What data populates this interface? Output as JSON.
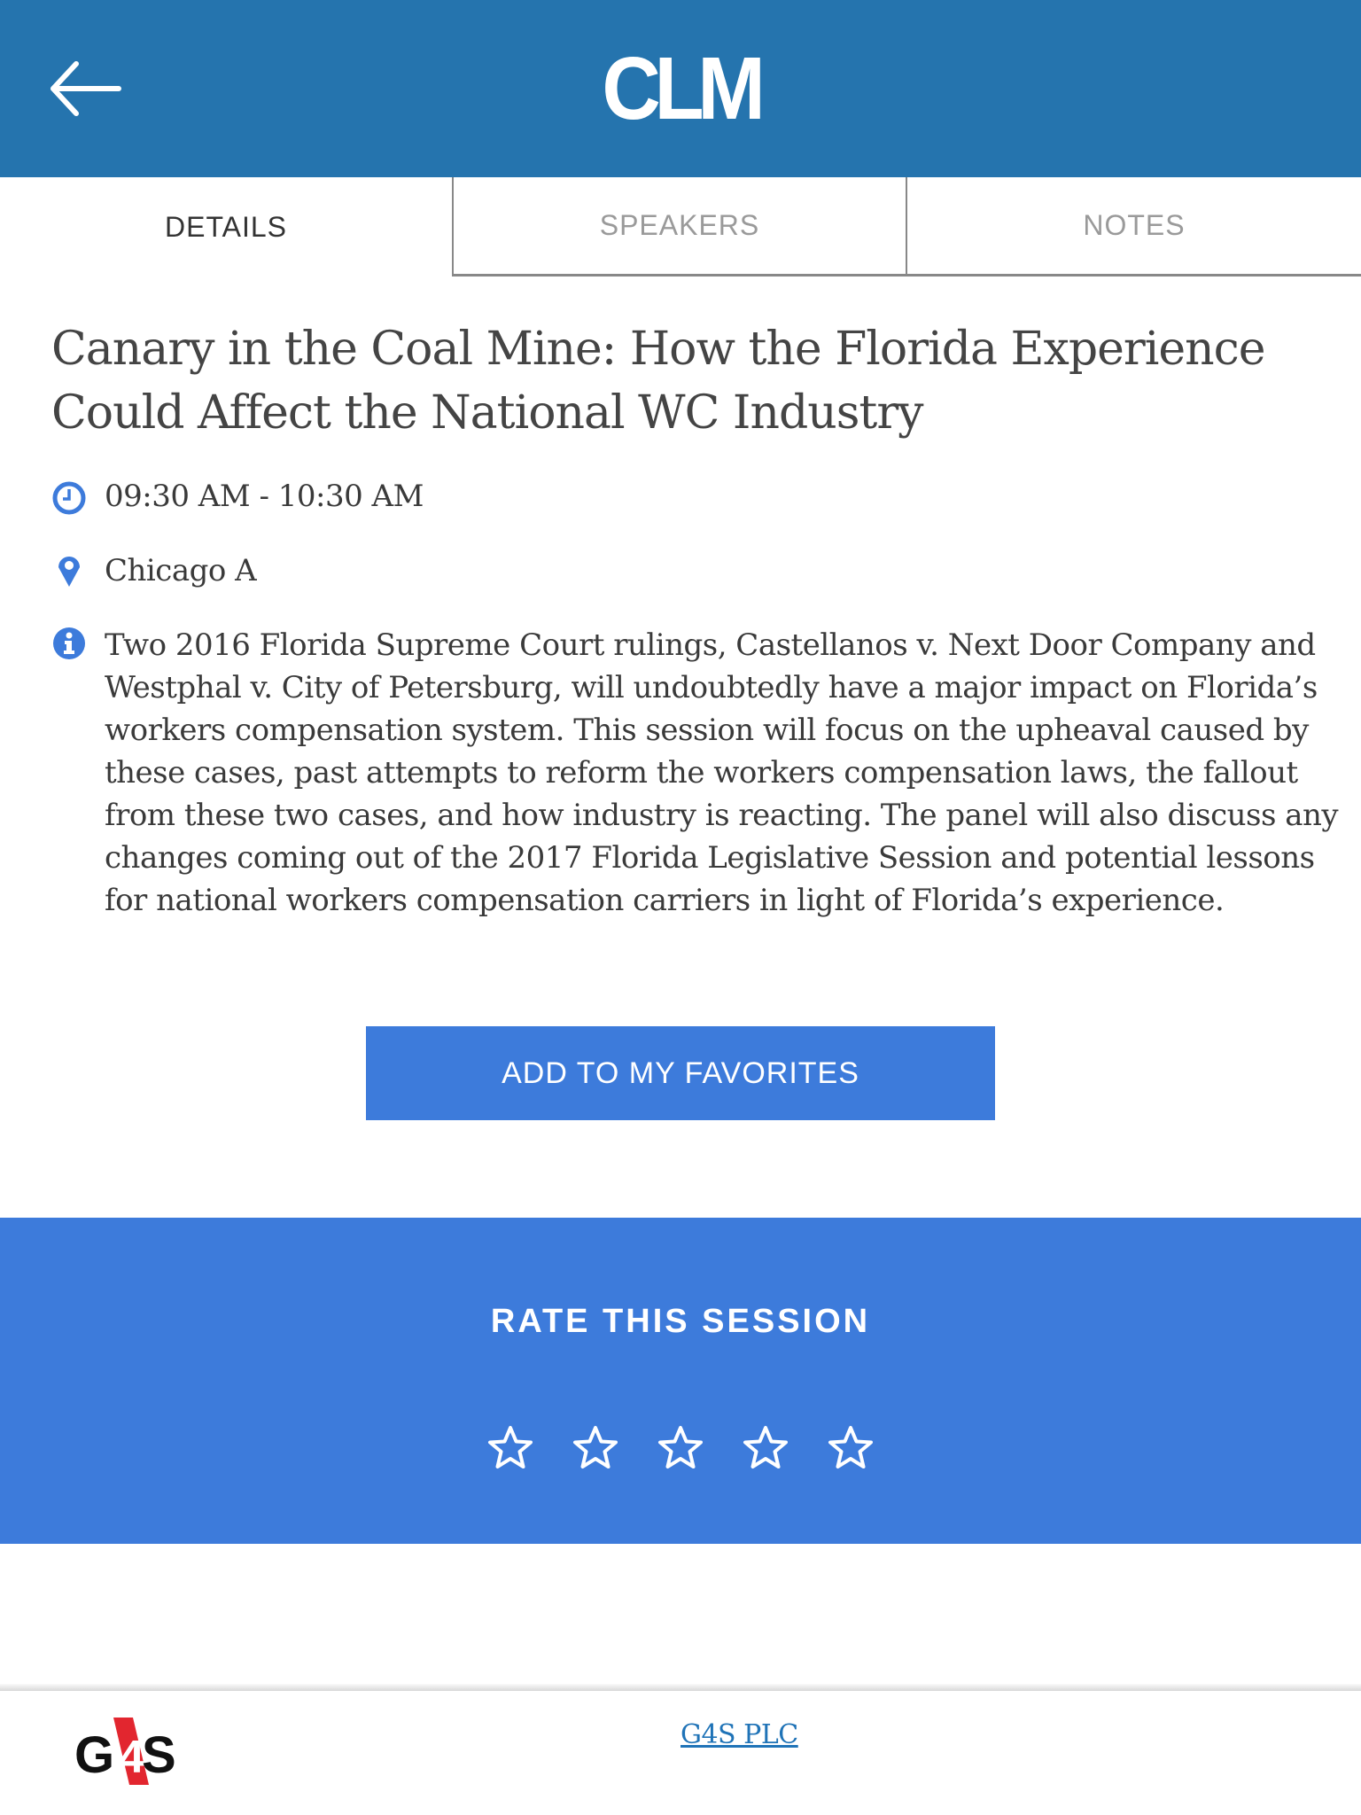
{
  "header": {
    "logo_text": "CLM",
    "back_icon": "arrow-left-icon",
    "background_color": "#2574ae"
  },
  "tabs": [
    {
      "label": "DETAILS",
      "active": true
    },
    {
      "label": "SPEAKERS",
      "active": false
    },
    {
      "label": "NOTES",
      "active": false
    }
  ],
  "session": {
    "title": "Canary in the Coal Mine: How the Florida Experience Could Affect the National WC Industry",
    "time": "09:30 AM - 10:30 AM",
    "time_icon": "clock-icon",
    "location": "Chicago A",
    "location_icon": "map-pin-icon",
    "description_icon": "info-icon",
    "description": "Two 2016 Florida Supreme Court rulings, Castellanos v. Next Door Company and Westphal v. City of Petersburg, will undoubtedly have a major impact on Florida’s workers compensation system.  This session will focus on the upheaval caused by these cases, past attempts to reform the workers compensation laws, the fallout from these two cases, and how industry is reacting.  The panel will also discuss any changes coming out of the 2017 Florida Legislative Session and potential lessons for national workers compensation carriers in light of Florida’s experience.",
    "accent_color": "#3d7bdb"
  },
  "favorites_button": {
    "label": "ADD TO MY FAVORITES"
  },
  "rating": {
    "title": "RATE THIS SESSION",
    "max_stars": 5,
    "current_rating": 0,
    "star_icon": "star-outline-icon"
  },
  "sponsor": {
    "logo_text": "G4S",
    "link_text": "G4S PLC",
    "link_color": "#1f73b7"
  }
}
